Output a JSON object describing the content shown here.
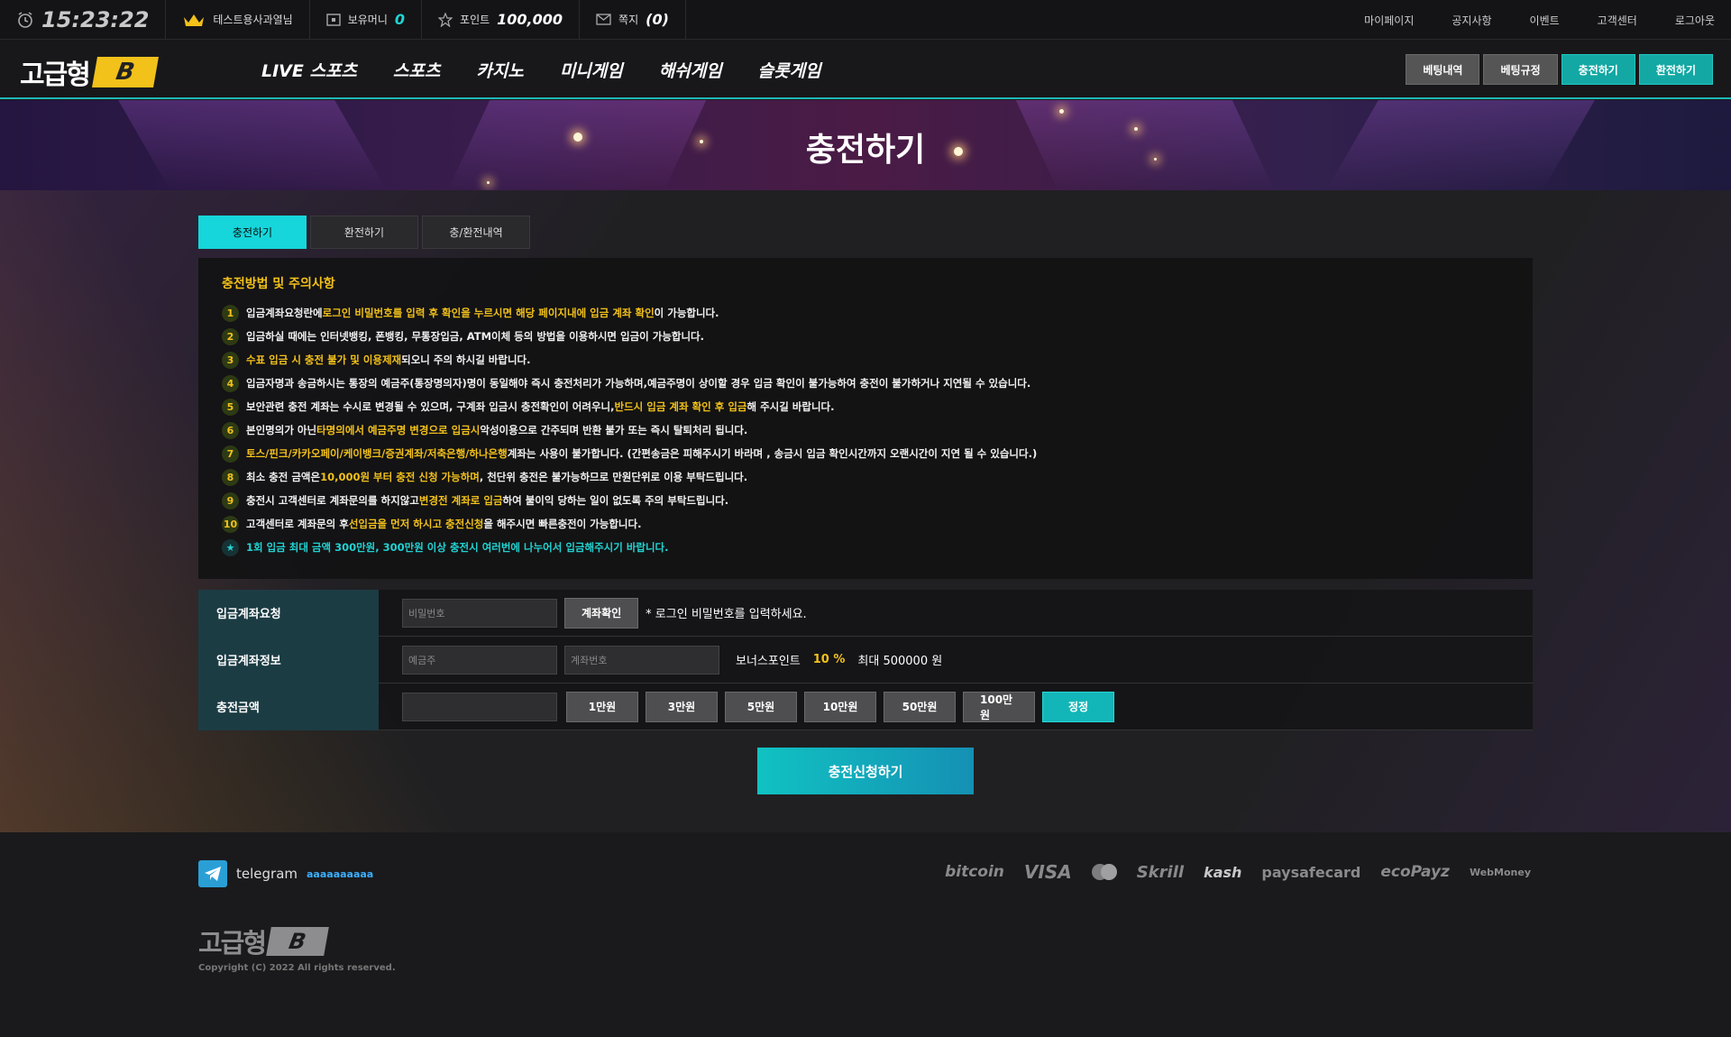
{
  "topbar": {
    "clock": "15:23:22",
    "user": "테스트용사과열님",
    "money_label": "보유머니",
    "money_value": "0",
    "point_label": "포인트",
    "point_value": "100,000",
    "message_label": "쪽지",
    "message_value": "(0)",
    "links": [
      "마이페이지",
      "공지사항",
      "이벤트",
      "고객센터",
      "로그아웃"
    ]
  },
  "nav": {
    "logo_text": "고급형",
    "logo_badge": "B",
    "menu": [
      "LIVE 스포츠",
      "스포츠",
      "카지노",
      "미니게임",
      "해쉬게임",
      "슬롯게임"
    ],
    "buttons": [
      "베팅내역",
      "베팅규정",
      "충전하기",
      "환전하기"
    ]
  },
  "banner": {
    "title": "충전하기"
  },
  "tabs": [
    "충전하기",
    "환전하기",
    "충/환전내역"
  ],
  "notice": {
    "title": "충전방법 및 주의사항",
    "items": [
      {
        "num": "1",
        "pre": "입금계좌요청란에 ",
        "hl": "로그인 비밀번호를 입력 후 확인을 누르시면 해당 페이지내에 입금 계좌 확인",
        "post": "이 가능합니다."
      },
      {
        "num": "2",
        "pre": "입금하실 때에는 인터넷뱅킹, 폰뱅킹, 무통장입금, ATM이체 등의 방법을 이용하시면 입금이 가능합니다.",
        "hl": "",
        "post": ""
      },
      {
        "num": "3",
        "pre": "",
        "hl": "수표 입금 시 충전 불가 및 이용제재",
        "post": " 되오니 주의 하시길 바랍니다."
      },
      {
        "num": "4",
        "pre": "입금자명과 송금하시는 통장의 예금주(통장명의자)명이 동일해야 즉시 충전처리가 가능하며,예금주명이 상이할 경우 입금 확인이 불가능하여 충전이 불가하거나 지연될 수 있습니다.",
        "hl": "",
        "post": ""
      },
      {
        "num": "5",
        "pre": "보안관련 충전 계좌는 수시로 변경될 수 있으며, 구계좌 입금시 충전확인이 어려우니, ",
        "hl": "반드시 입금 계좌 확인 후 입금",
        "post": "해 주시길 바랍니다."
      },
      {
        "num": "6",
        "pre": "본인명의가 아닌 ",
        "hl": "타명의에서 예금주명 변경으로 입금시",
        "post": " 악성이용으로 간주되며 반환 불가 또는 즉시 탈퇴처리 됩니다."
      },
      {
        "num": "7",
        "pre": "",
        "hl": "토스/핀크/카카오페이/케이뱅크/증권계좌/저축은행/하나은행",
        "post": " 계좌는 사용이 불가합니다. (간편송금은 피해주시기 바라며 , 송금시 입금 확인시간까지 오랜시간이 지연 될 수 있습니다.)"
      },
      {
        "num": "8",
        "pre": "최소 충전 금액은 ",
        "hl": "10,000원 부터 충전 신청 가능하며",
        "post": ", 천단위 충전은 불가능하므로 만원단위로 이용 부탁드립니다."
      },
      {
        "num": "9",
        "pre": "충전시 고객센터로 계좌문의를 하지않고 ",
        "hl": "변경전 계좌로 입금",
        "post": "하여 불이익 당하는 일이 없도록 주의 부탁드립니다."
      },
      {
        "num": "10",
        "pre": "고객센터로 계좌문의 후 ",
        "hl": "선입금을 먼저 하시고 충전신청",
        "post": "을 해주시면 빠른충전이 가능합니다."
      }
    ],
    "star_text": "1회 입금 최대 금액 300만원, 300만원 이상 충전시 여러번에 나누어서 입금해주시기 바랍니다."
  },
  "form": {
    "row1": {
      "label": "입금계좌요청",
      "placeholder": "비밀번호",
      "button": "계좌확인",
      "hint": "* 로그인 비밀번호를 입력하세요."
    },
    "row2": {
      "label": "입금계좌정보",
      "placeholder1": "예금주",
      "placeholder2": "계좌번호",
      "bonus_label": "보너스포인트",
      "bonus_value": "10 %",
      "max_text": "최대 500000 원"
    },
    "row3": {
      "label": "충전금액",
      "amounts": [
        "1만원",
        "3만원",
        "5만원",
        "10만원",
        "50만원",
        "100만원"
      ],
      "reset": "정정"
    },
    "submit": "충전신청하기"
  },
  "footer": {
    "telegram_label": "telegram",
    "telegram_id": "aaaaaaaaaa",
    "payments": [
      "bitcoin",
      "VISA",
      "",
      "Skrill",
      "kash",
      "paysafecard",
      "ecoPayz",
      "WebMoney"
    ],
    "logo_text": "고급형",
    "logo_badge": "B",
    "copyright": "Copyright (C) 2022 All rights reserved."
  },
  "colors": {
    "accent": "#16d6db",
    "gold": "#f2c11a",
    "teal_dark": "#13a8a4"
  }
}
